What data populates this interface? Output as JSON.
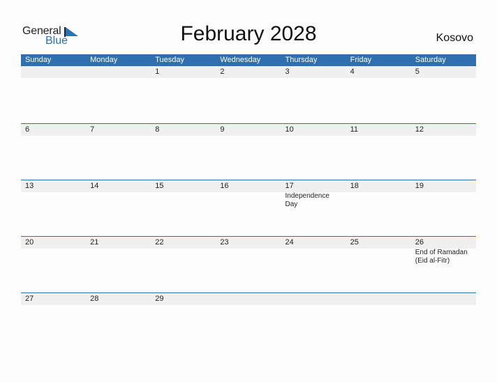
{
  "logo": {
    "general": "General",
    "blue": "Blue"
  },
  "title": "February 2028",
  "country": "Kosovo",
  "weekdays": [
    "Sunday",
    "Monday",
    "Tuesday",
    "Wednesday",
    "Thursday",
    "Friday",
    "Saturday"
  ],
  "weeks": [
    {
      "days": [
        "",
        "",
        "1",
        "2",
        "3",
        "4",
        "5"
      ],
      "events": [
        "",
        "",
        "",
        "",
        "",
        "",
        ""
      ]
    },
    {
      "days": [
        "6",
        "7",
        "8",
        "9",
        "10",
        "11",
        "12"
      ],
      "events": [
        "",
        "",
        "",
        "",
        "",
        "",
        ""
      ]
    },
    {
      "days": [
        "13",
        "14",
        "15",
        "16",
        "17",
        "18",
        "19"
      ],
      "events": [
        "",
        "",
        "",
        "",
        "Independence Day",
        "",
        ""
      ]
    },
    {
      "days": [
        "20",
        "21",
        "22",
        "23",
        "24",
        "25",
        "26"
      ],
      "events": [
        "",
        "",
        "",
        "",
        "",
        "",
        "End of Ramadan (Eid al-Fitr)"
      ]
    },
    {
      "days": [
        "27",
        "28",
        "29",
        "",
        "",
        "",
        ""
      ],
      "events": [
        "",
        "",
        "",
        "",
        "",
        "",
        ""
      ]
    }
  ],
  "colors": {
    "accent": "#2e6fb0",
    "strip": "#f0f0f0"
  }
}
